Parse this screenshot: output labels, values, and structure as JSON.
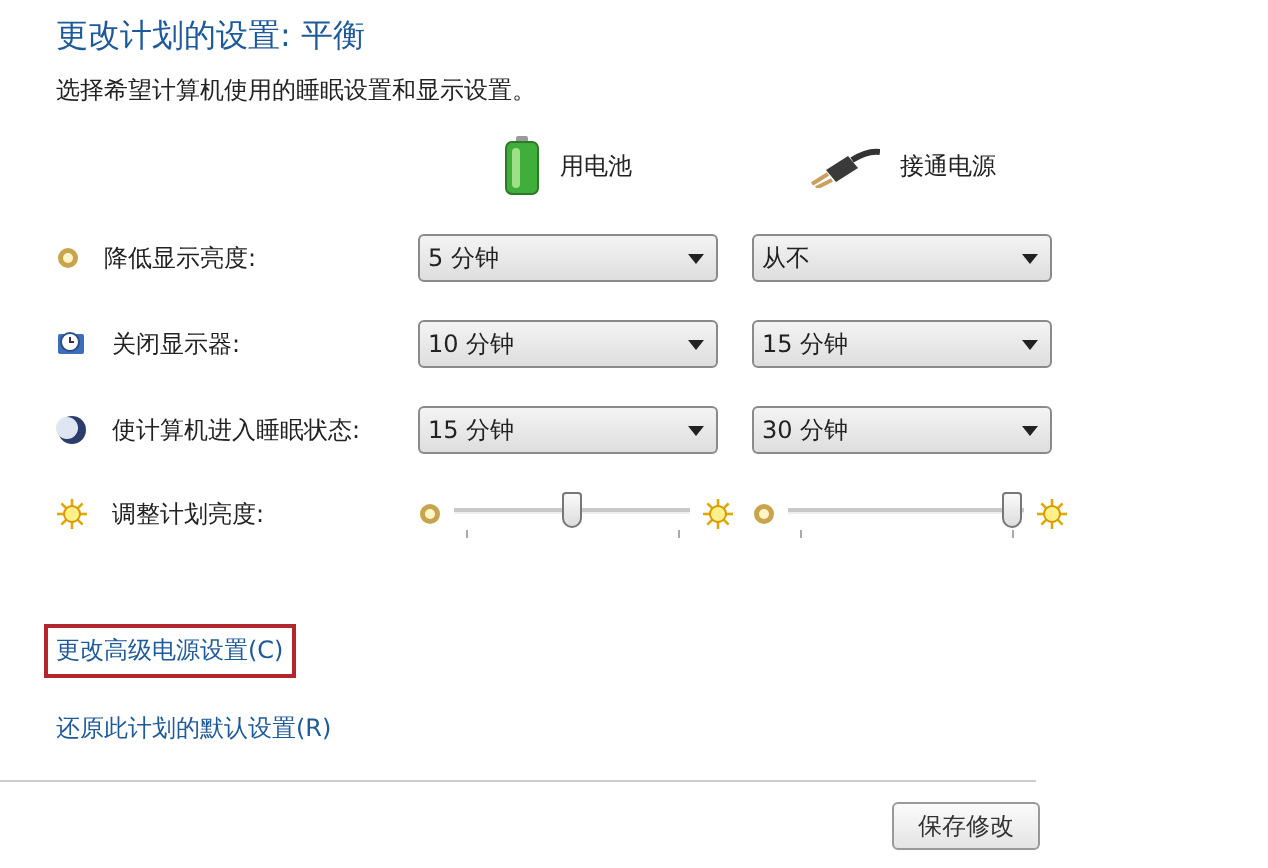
{
  "title": "更改计划的设置: 平衡",
  "subtitle": "选择希望计算机使用的睡眠设置和显示设置。",
  "columns": [
    {
      "kind": "battery",
      "label": "用电池"
    },
    {
      "kind": "plug",
      "label": "接通电源"
    }
  ],
  "rows": [
    {
      "kind": "dropdown",
      "label": "降低显示亮度:",
      "values": [
        "5 分钟",
        "从不"
      ]
    },
    {
      "kind": "dropdown",
      "label": "关闭显示器:",
      "values": [
        "10 分钟",
        "15 分钟"
      ]
    },
    {
      "kind": "dropdown",
      "label": "使计算机进入睡眠状态:",
      "values": [
        "15 分钟",
        "30 分钟"
      ]
    },
    {
      "kind": "slider",
      "label": "调整计划亮度:",
      "sliders": [
        {
          "level": 0.5
        },
        {
          "level": 1.0
        }
      ]
    }
  ],
  "links": [
    {
      "label": "更改高级电源设置(C)",
      "highlighted": true
    },
    {
      "label": "还原此计划的默认设置(R)",
      "highlighted": false
    }
  ],
  "buttons": [
    "保存修改"
  ]
}
